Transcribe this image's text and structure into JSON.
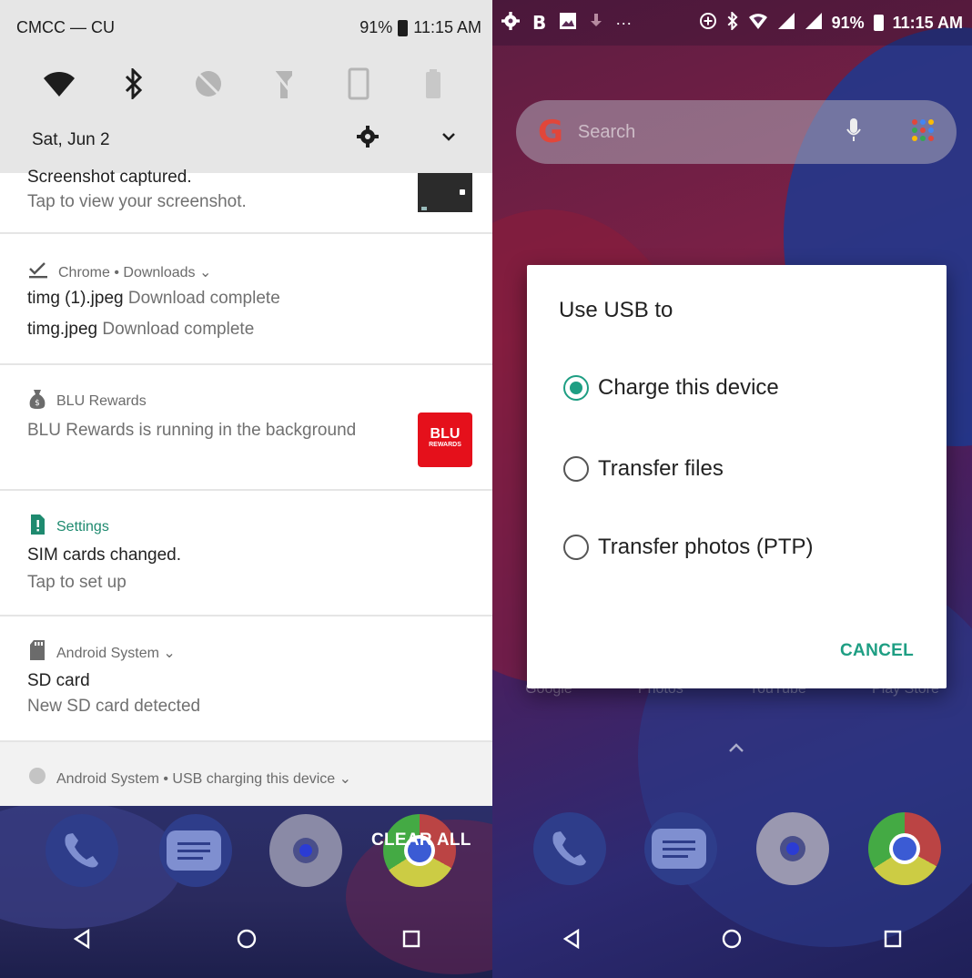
{
  "left": {
    "status": {
      "carrier": "CMCC — CU",
      "battery": "91%",
      "time": "11:15 AM"
    },
    "quick_settings": {
      "tiles": [
        "wifi-icon",
        "bluetooth-icon",
        "location-off-icon",
        "flashlight-off-icon",
        "screen-rotate-icon",
        "battery-saver-icon"
      ],
      "date": "Sat, Jun 2"
    },
    "notifications": {
      "screenshot": {
        "title": "Screenshot captured.",
        "subtitle": "Tap to view your screenshot."
      },
      "chrome": {
        "app": "Chrome • Downloads ⌄",
        "items": [
          {
            "name": "timg (1).jpeg",
            "status": "Download complete"
          },
          {
            "name": "timg.jpeg",
            "status": "Download complete"
          }
        ]
      },
      "blu": {
        "app": "BLU Rewards",
        "body": "BLU Rewards is running in the background",
        "logo_top": "BLU",
        "logo_bottom": "REWARDS"
      },
      "settings": {
        "app": "Settings",
        "title": "SIM cards changed.",
        "subtitle": "Tap to set up"
      },
      "android_sd": {
        "app": "Android System ⌄",
        "title": "SD card",
        "subtitle": "New SD card detected"
      },
      "android_usb": {
        "app": "Android System • USB charging this device ⌄"
      }
    },
    "clear_all": "CLEAR ALL"
  },
  "right": {
    "status": {
      "battery": "91%",
      "time": "11:15 AM"
    },
    "search": {
      "placeholder": "Search"
    },
    "app_labels": [
      "Google",
      "Photos",
      "YouTube",
      "Play Store"
    ],
    "dialog": {
      "title": "Use USB to",
      "options": [
        {
          "label": "Charge this device",
          "selected": true
        },
        {
          "label": "Transfer files",
          "selected": false
        },
        {
          "label": "Transfer photos (PTP)",
          "selected": false
        }
      ],
      "cancel": "CANCEL"
    }
  },
  "colors": {
    "accent": "#1e9e83",
    "settings_green": "#1e8a6f",
    "blu_red": "#e5101b"
  }
}
